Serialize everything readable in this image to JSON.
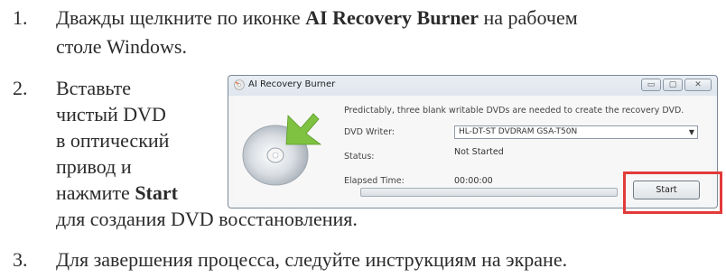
{
  "steps": [
    {
      "number": "1.",
      "pre": "Дважды щелкните по иконке ",
      "bold": "AI Recovery Burner",
      "post": " на рабочем",
      "line2": "столе Windows."
    },
    {
      "number": "2.",
      "lines": [
        "Вставьте",
        "чистый DVD",
        "в оптический",
        "привод и"
      ],
      "line5_pre": "нажмите ",
      "line5_bold": "Start",
      "line6": "для создания DVD восстановления."
    },
    {
      "number": "3.",
      "text": "Для завершения процесса, следуйте инструкциям на экране."
    }
  ],
  "window": {
    "title": "AI Recovery Burner",
    "info": "Predictably, three blank writable DVDs are needed to create the recovery DVD.",
    "writer_label": "DVD Writer:",
    "writer_value": "HL-DT-ST DVDRAM GSA-T50N",
    "status_label": "Status:",
    "status_value": "Not Started",
    "elapsed_label": "Elapsed Time:",
    "elapsed_value": "00:00:00",
    "start_label": "Start",
    "progress": 0,
    "icons": {
      "app": "disc-icon",
      "minimize": "minimize-icon",
      "maximize": "maximize-icon",
      "close": "close-icon",
      "dropdown": "chevron-down-icon",
      "disc": "dvd-disc-icon"
    },
    "colors": {
      "highlight": "#e23a3a",
      "arrow": "#7fc242"
    }
  }
}
